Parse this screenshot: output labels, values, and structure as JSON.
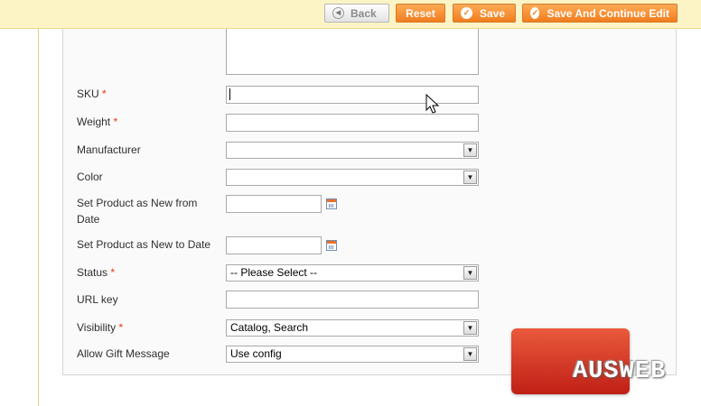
{
  "toolbar": {
    "back_label": "Back",
    "reset_label": "Reset",
    "save_label": "Save",
    "save_continue_label": "Save And Continue Edit"
  },
  "form": {
    "required_marker": "*",
    "sku": {
      "label": "SKU",
      "value": ""
    },
    "weight": {
      "label": "Weight",
      "value": ""
    },
    "manufacturer": {
      "label": "Manufacturer",
      "selected": ""
    },
    "color": {
      "label": "Color",
      "selected": ""
    },
    "news_from_date": {
      "label_line1": "Set Product as New from",
      "label_line2": "Date",
      "value": ""
    },
    "news_to_date": {
      "label": "Set Product as New to Date",
      "value": ""
    },
    "status": {
      "label": "Status",
      "selected": "-- Please Select --"
    },
    "url_key": {
      "label": "URL key",
      "value": ""
    },
    "visibility": {
      "label": "Visibility",
      "selected": "Catalog, Search"
    },
    "gift_message": {
      "label": "Allow Gift Message",
      "selected": "Use config"
    }
  },
  "watermark": {
    "text": "AUSWEB"
  },
  "colors": {
    "accent": "#f07d1e",
    "toolbar_bg": "#fdf4c6",
    "required": "#eb340a",
    "logo": "#d63a27"
  }
}
